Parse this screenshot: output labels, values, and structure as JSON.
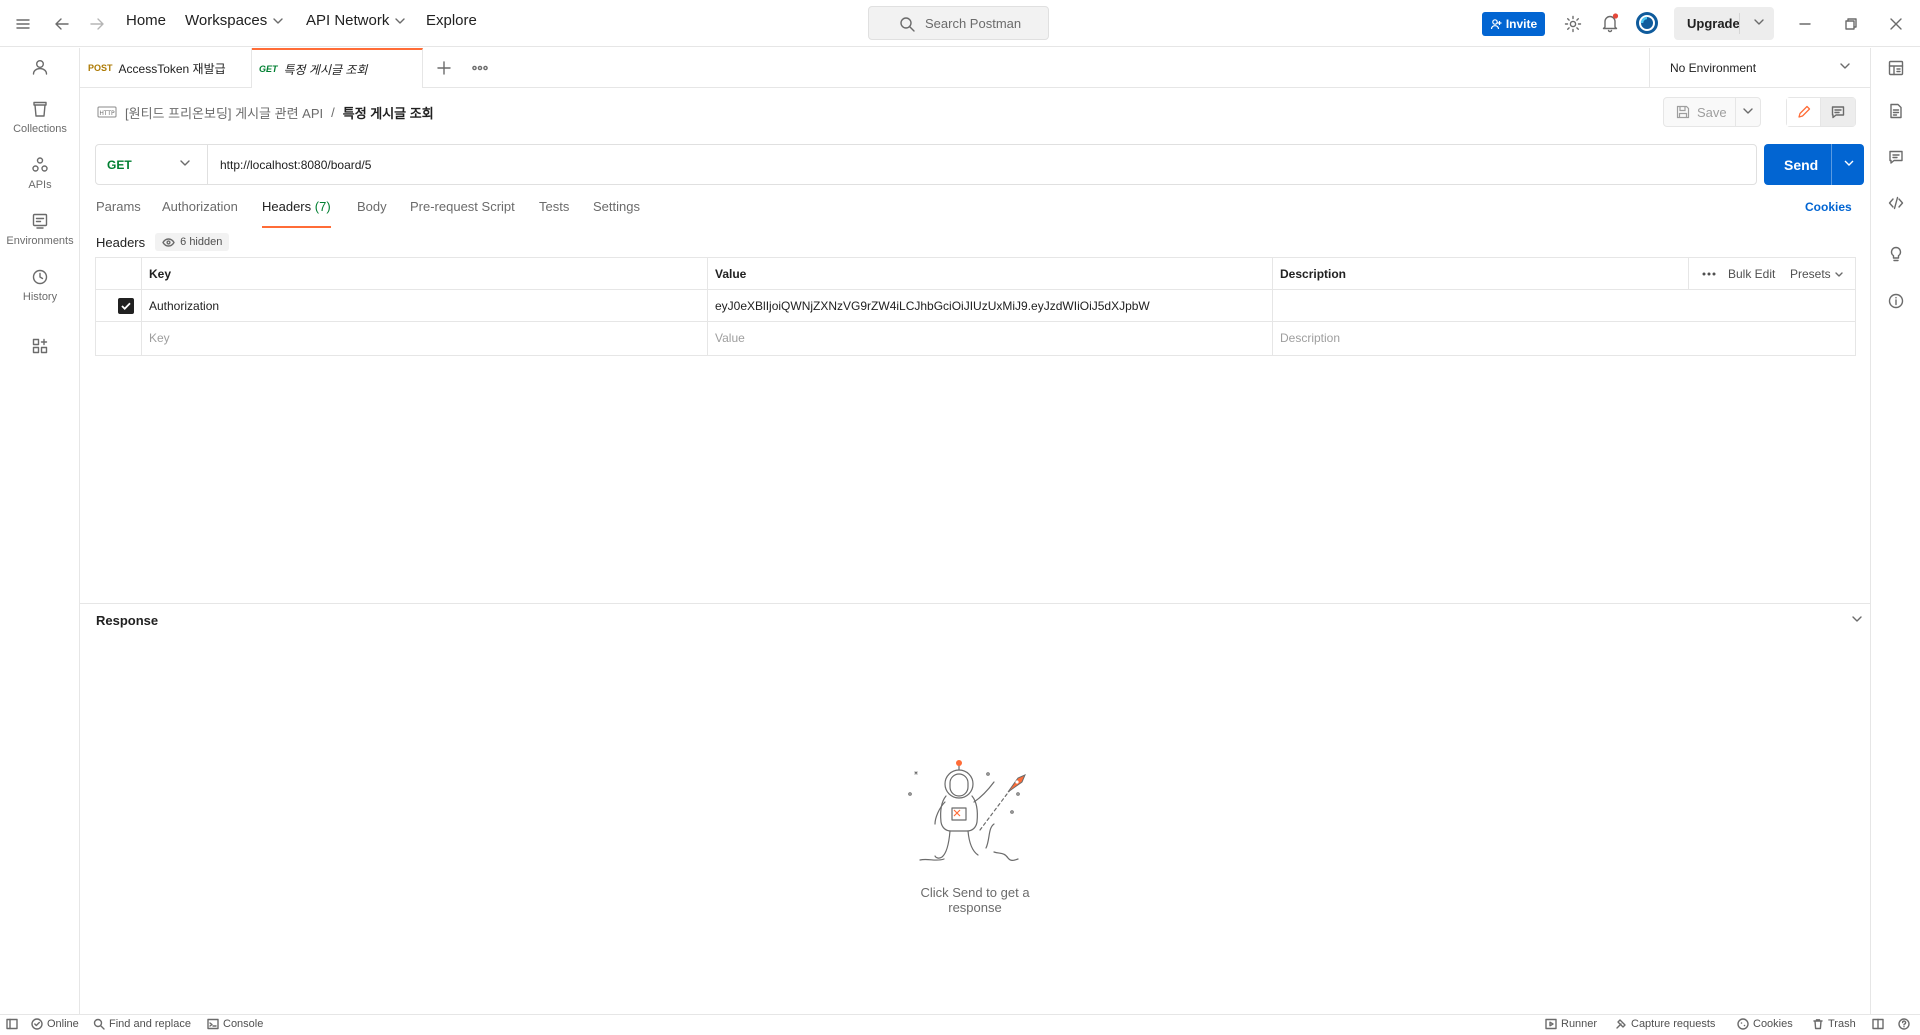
{
  "topbar": {
    "nav": {
      "home": "Home",
      "workspaces": "Workspaces",
      "api_network": "API Network",
      "explore": "Explore"
    },
    "search_placeholder": "Search Postman",
    "invite_label": "Invite",
    "upgrade_label": "Upgrade"
  },
  "sidebar": {
    "items": [
      {
        "label": "Collections",
        "icon": "collections-icon"
      },
      {
        "label": "APIs",
        "icon": "apis-icon"
      },
      {
        "label": "Environments",
        "icon": "environments-icon"
      },
      {
        "label": "History",
        "icon": "history-icon"
      }
    ]
  },
  "tabs": [
    {
      "method": "POST",
      "name": "AccessToken 재발급",
      "method_color": "#ad7a03"
    },
    {
      "method": "GET",
      "name": "특정 게시글 조회",
      "method_color": "#007f31",
      "active": true
    }
  ],
  "environment": {
    "label": "No Environment"
  },
  "breadcrumb": {
    "parent": "[원티드 프리온보딩] 게시글 관련 API",
    "separator": "/",
    "current": "특정 게시글 조회"
  },
  "save_label": "Save",
  "request": {
    "method": "GET",
    "url": "http://localhost:8080/board/5",
    "send_label": "Send"
  },
  "request_tabs": {
    "params": "Params",
    "authorization": "Authorization",
    "headers": "Headers",
    "headers_count": "(7)",
    "body": "Body",
    "pre_request": "Pre-request Script",
    "tests": "Tests",
    "settings": "Settings",
    "cookies": "Cookies"
  },
  "headers_section": {
    "title": "Headers",
    "hidden_label": "6 hidden",
    "columns": {
      "key": "Key",
      "value": "Value",
      "description": "Description"
    },
    "bulk_edit": "Bulk Edit",
    "presets": "Presets",
    "rows": [
      {
        "checked": true,
        "key": "Authorization",
        "value": "eyJ0eXBlIjoiQWNjZXNzVG9rZW4iLCJhbGciOiJIUzUxMiJ9.eyJzdWIiOiJ5dXJpbW",
        "description": ""
      }
    ],
    "placeholder": {
      "key": "Key",
      "value": "Value",
      "description": "Description"
    }
  },
  "response": {
    "title": "Response",
    "empty_message": "Click Send to get a response"
  },
  "statusbar": {
    "online": "Online",
    "find_replace": "Find and replace",
    "console": "Console",
    "runner": "Runner",
    "capture": "Capture requests",
    "cookies": "Cookies",
    "trash": "Trash"
  },
  "colors": {
    "accent": "#ff6c37",
    "primary": "#0265d2",
    "get_method": "#007f31",
    "post_method": "#ad7a03"
  }
}
